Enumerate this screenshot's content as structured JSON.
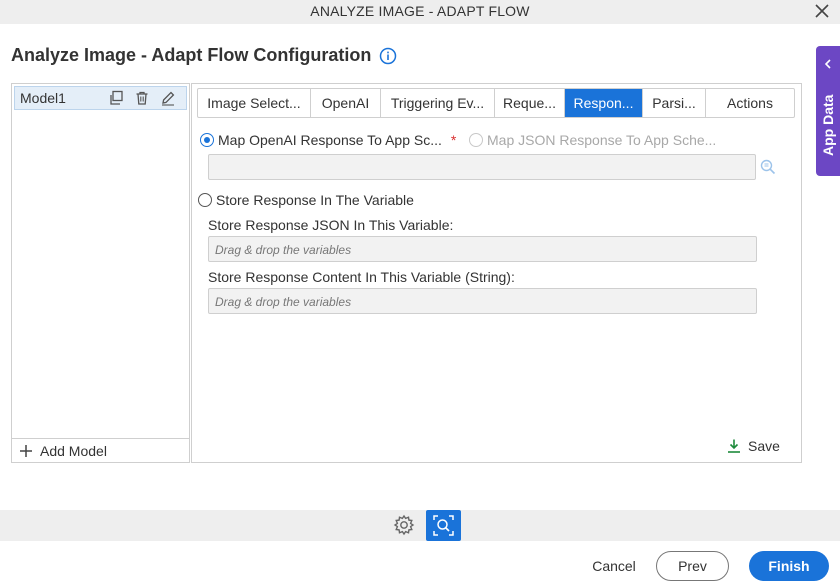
{
  "window": {
    "title": "ANALYZE IMAGE - ADAPT FLOW",
    "close_icon": "close-icon"
  },
  "page": {
    "heading": "Analyze Image - Adapt Flow Configuration",
    "info_icon": "info-icon"
  },
  "side_tab": {
    "label": "App Data",
    "icon": "chevron-left-icon",
    "color": "#6c47c4"
  },
  "models": {
    "items": [
      {
        "label": "Model1"
      }
    ],
    "row_icons": [
      "copy-icon",
      "trash-icon",
      "edit-icon"
    ],
    "add_label": "Add Model"
  },
  "tabs": [
    {
      "label": "Image Select..."
    },
    {
      "label": "OpenAI"
    },
    {
      "label": "Triggering Ev..."
    },
    {
      "label": "Reque..."
    },
    {
      "label": "Respon...",
      "active": true
    },
    {
      "label": "Parsi..."
    },
    {
      "label": "Actions"
    }
  ],
  "response": {
    "option_map_openai": "Map OpenAI Response To App Sc...",
    "required_mark": "*",
    "option_map_json": "Map JSON Response To App Sche...",
    "option_store_variable": "Store Response In The Variable",
    "json_var_label": "Store Response JSON In This Variable:",
    "json_var_placeholder": "Drag & drop the variables",
    "content_var_label": "Store Response Content In This Variable (String):",
    "content_var_placeholder": "Drag & drop the variables",
    "save_label": "Save"
  },
  "footer": {
    "cancel": "Cancel",
    "prev": "Prev",
    "finish": "Finish",
    "accent_color": "#1a73d9"
  }
}
